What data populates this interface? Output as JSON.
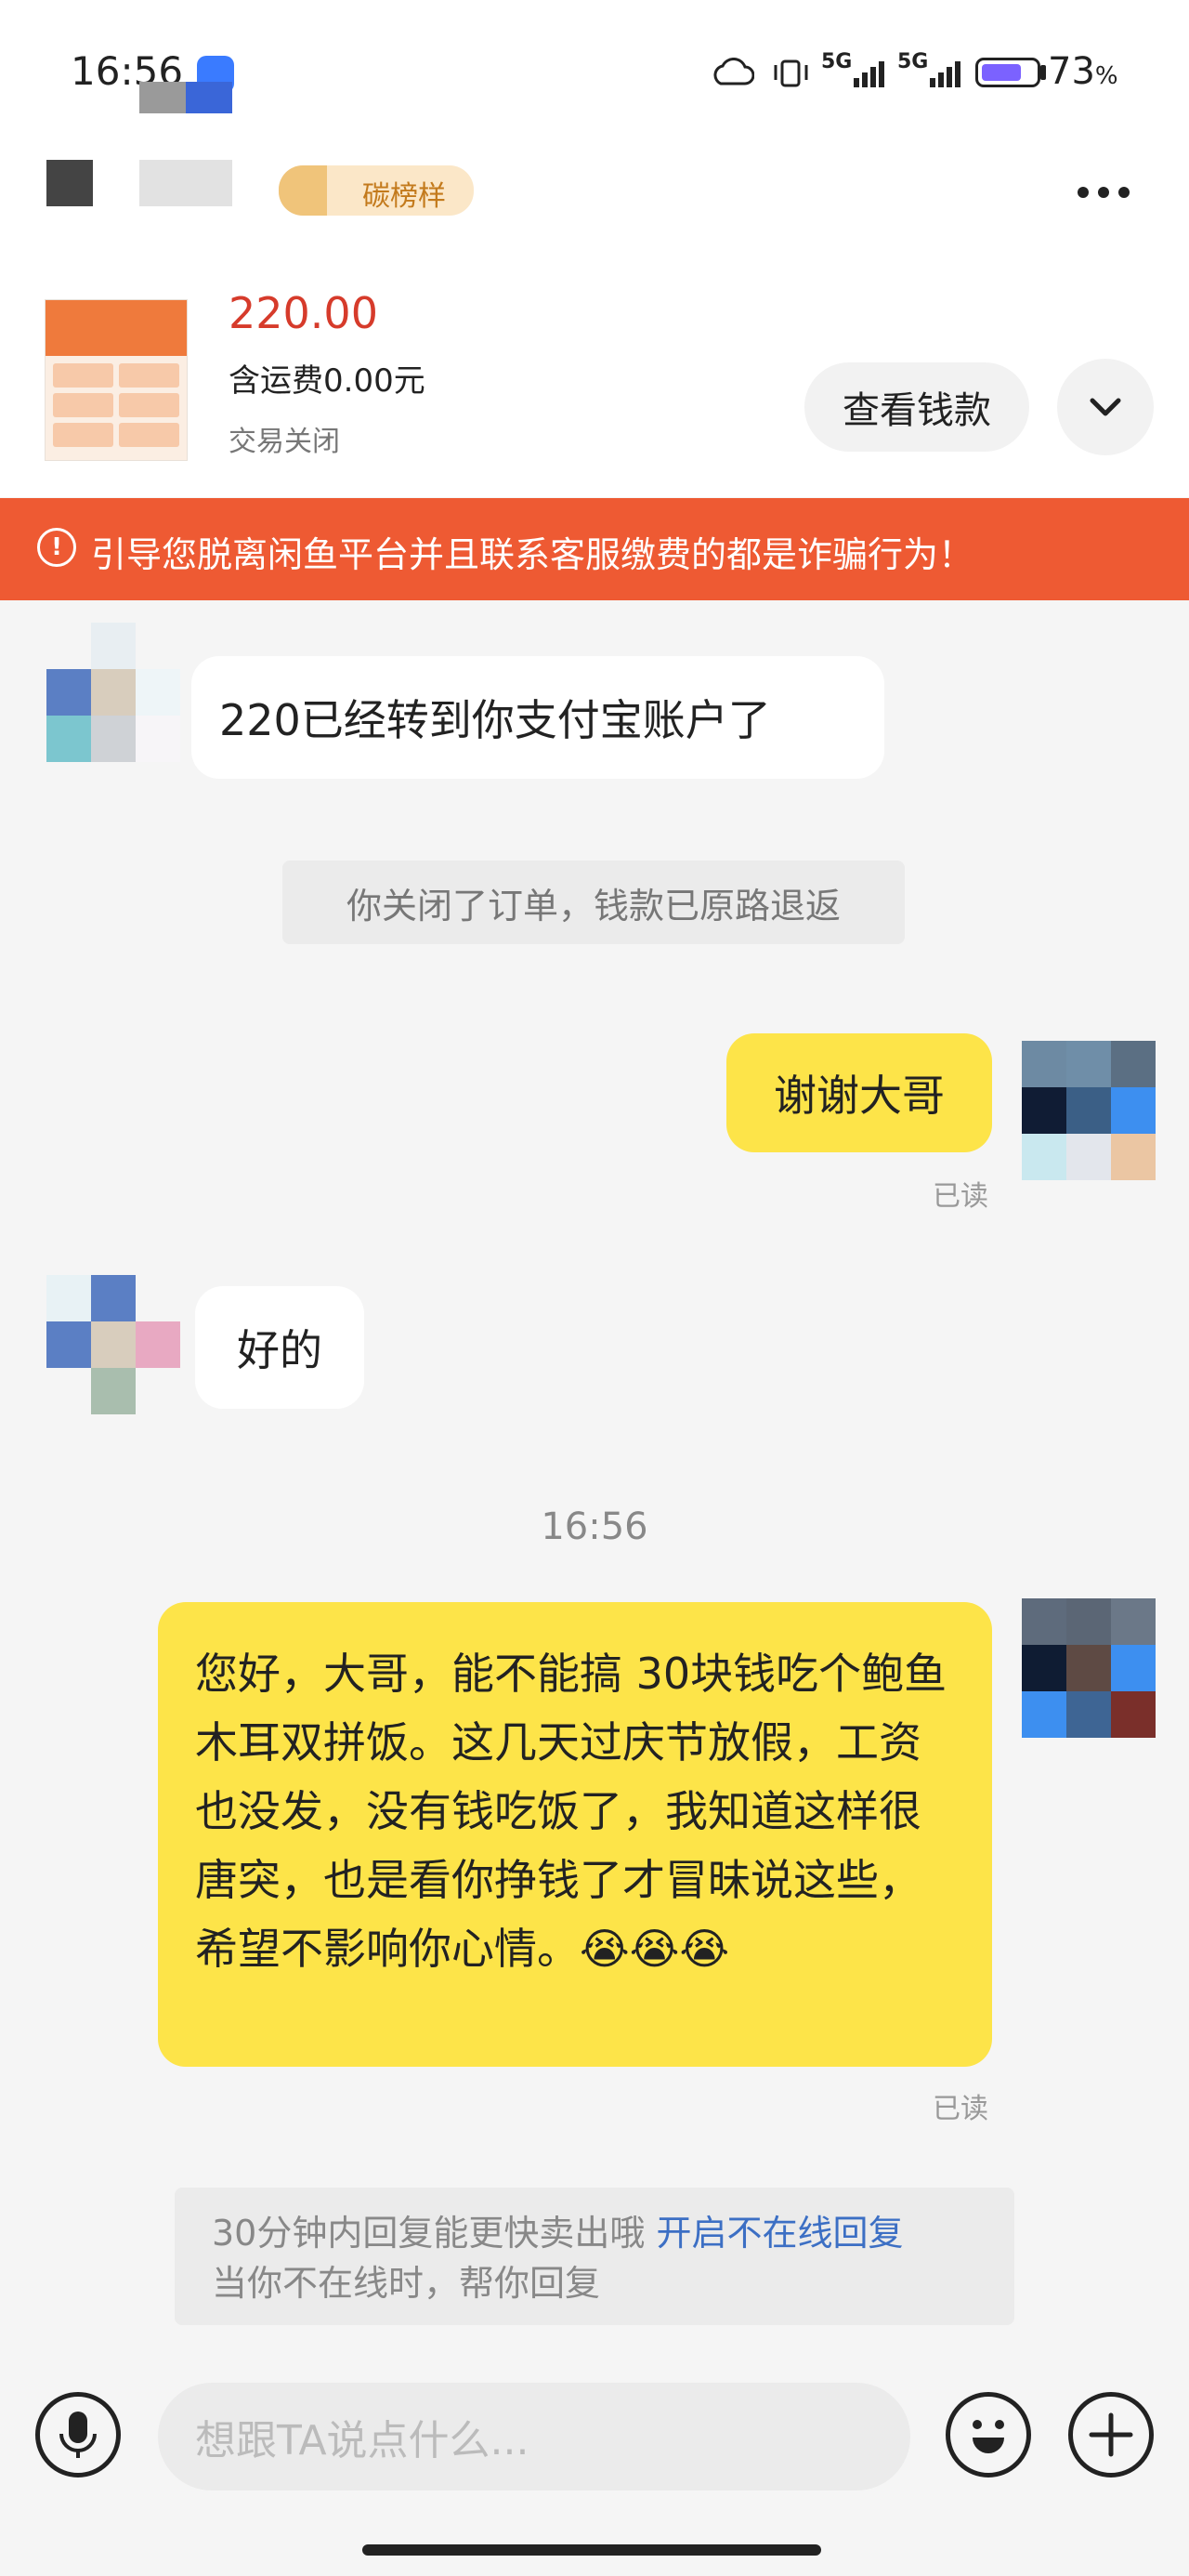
{
  "status_bar": {
    "time": "16:56",
    "network_1": "5G",
    "network_2": "5G",
    "battery_percent": "73",
    "battery_unit": "%",
    "battery_level": 0.73
  },
  "header": {
    "badge_text": "碳榜样",
    "more_icon": "more-icon"
  },
  "product": {
    "price": "220.00",
    "shipping": "含运费0.00元",
    "status": "交易关闭",
    "view_button": "查看钱款",
    "expand_icon": "chevron-down-icon"
  },
  "warning": {
    "icon": "!",
    "text": "引导您脱离闲鱼平台并且联系客服缴费的都是诈骗行为！"
  },
  "messages": {
    "m1": "220已经转到你支付宝账户了",
    "sys1": "你关闭了订单，钱款已原路退返",
    "m2": "谢谢大哥",
    "m2_read": "已读",
    "m3": "好的",
    "timestamp": "16:56",
    "m4": "您好，大哥，能不能搞 30块钱吃个鲍鱼木耳双拼饭。这几天过庆节放假，工资也没发，没有钱吃饭了，我知道这样很唐突，也是看你挣钱了才冒昧说这些，希望不影响你心情。😭😭😭",
    "m4_read": "已读"
  },
  "tip": {
    "line1": "30分钟内回复能更快卖出哦",
    "link": "开启不在线回复",
    "line2": "当你不在线时，帮你回复"
  },
  "input_bar": {
    "placeholder": "想跟TA说点什么..."
  },
  "colors": {
    "accent_yellow": "#fde449",
    "warning_orange": "#ee5a33",
    "price_red": "#d63b2b",
    "link_blue": "#3c6fc4"
  }
}
